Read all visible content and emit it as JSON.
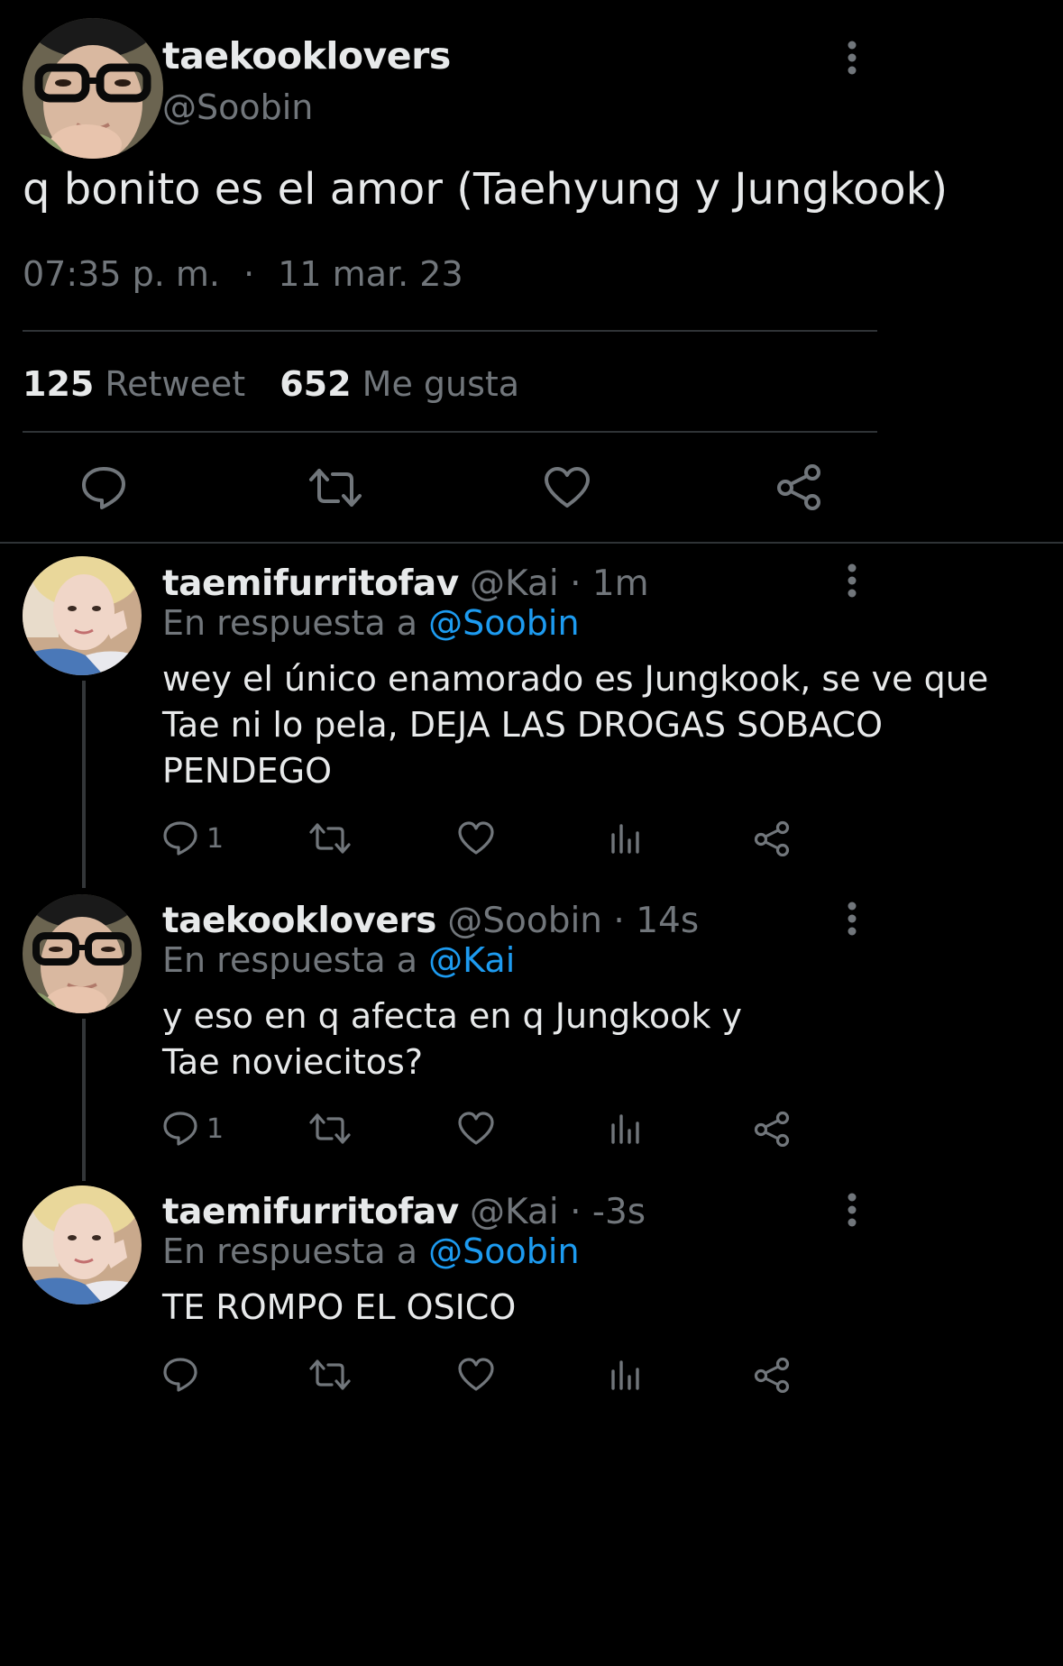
{
  "colors": {
    "background": "#000000",
    "text": "#e7e9ea",
    "muted": "#71767b",
    "link": "#1d9bf0",
    "divider": "#2f3336"
  },
  "main_tweet": {
    "display_name": "taekooklovers",
    "handle": "@Soobin",
    "text": "q bonito es el amor (Taehyung y Jungkook)",
    "time": "07:35 p. m.",
    "separator": "·",
    "date": "11 mar. 23",
    "retweets_count": "125",
    "retweets_label": "Retweet",
    "likes_count": "652",
    "likes_label": "Me gusta",
    "icons": [
      "reply-icon",
      "retweet-icon",
      "like-icon",
      "share-icon"
    ]
  },
  "replies": [
    {
      "display_name": "taemifurritofav",
      "handle": "@Kai",
      "time": "· 1m",
      "reply_prefix": "En respuesta a",
      "reply_to": "@Soobin",
      "text": "wey el único enamorado es Jungkook, se ve que Tae ni lo pela, DEJA LAS DROGAS SOBACO PENDEGO",
      "reply_count": "1"
    },
    {
      "display_name": "taekooklovers",
      "handle": "@Soobin",
      "time": "· 14s",
      "reply_prefix": "En respuesta a",
      "reply_to": "@Kai",
      "text": "y eso en q afecta en q Jungkook y Tae noviecitos?",
      "reply_count": "1"
    },
    {
      "display_name": "taemifurritofav",
      "handle": "@Kai",
      "time": "· -3s",
      "reply_prefix": "En respuesta a",
      "reply_to": "@Soobin",
      "text": "TE ROMPO EL OSICO",
      "reply_count": ""
    }
  ]
}
